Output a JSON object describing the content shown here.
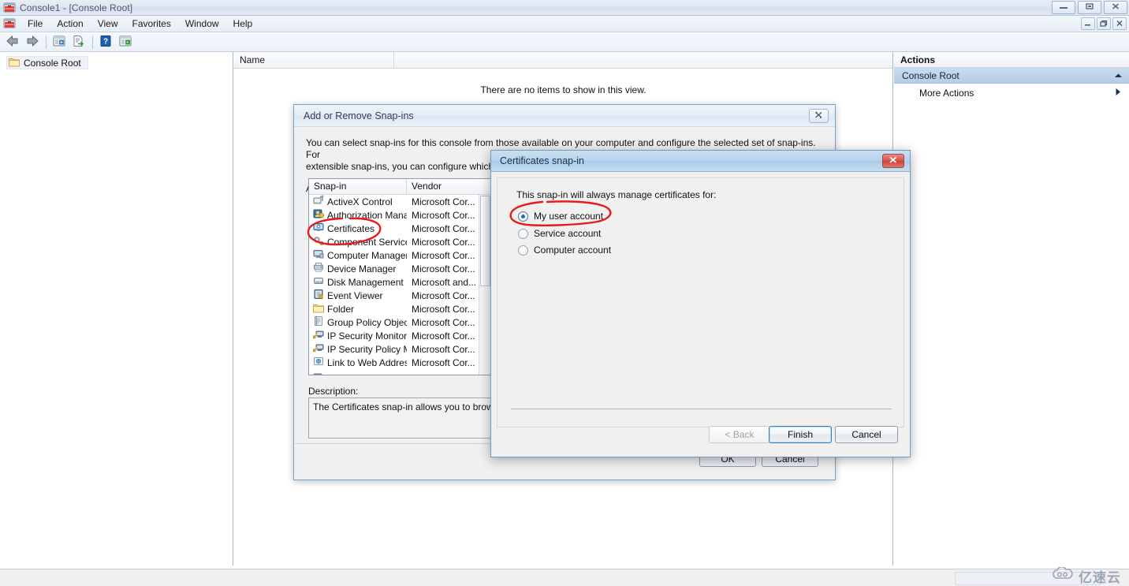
{
  "window": {
    "title": "Console1 - [Console Root]",
    "icon": "mmc-console-icon",
    "controls": {
      "minimize": "–",
      "maximize": "▣",
      "close": "✕"
    },
    "mdi_controls": {
      "minimize": "–",
      "restore": "❐",
      "close": "✕"
    }
  },
  "menu": {
    "items": [
      {
        "label": "File",
        "name": "menu-file"
      },
      {
        "label": "Action",
        "name": "menu-action"
      },
      {
        "label": "View",
        "name": "menu-view"
      },
      {
        "label": "Favorites",
        "name": "menu-favorites"
      },
      {
        "label": "Window",
        "name": "menu-window"
      },
      {
        "label": "Help",
        "name": "menu-help"
      }
    ]
  },
  "toolbar": {
    "buttons": [
      {
        "name": "back-button",
        "icon": "back-arrow-icon"
      },
      {
        "name": "forward-button",
        "icon": "forward-arrow-icon"
      },
      {
        "name": "show-hide-tree-button",
        "icon": "console-tree-icon"
      },
      {
        "name": "export-list-button",
        "icon": "export-list-icon"
      },
      {
        "name": "help-button",
        "icon": "question-mark-icon"
      },
      {
        "name": "show-action-pane-button",
        "icon": "action-pane-icon"
      }
    ]
  },
  "tree": {
    "root": {
      "label": "Console Root",
      "icon": "folder-icon"
    }
  },
  "list_pane": {
    "columns": [
      "Name",
      ""
    ],
    "empty_message": "There are no items to show in this view."
  },
  "actions_pane": {
    "title": "Actions",
    "group_label": "Console Root",
    "group_collapse_icon": "chevron-up-icon",
    "items": [
      {
        "label": "More Actions",
        "submenu_icon": "chevron-right-icon"
      }
    ]
  },
  "snapins_dialog": {
    "title": "Add or Remove Snap-ins",
    "close_label": "✕",
    "intro_line1": "You can select snap-ins for this console from those available on your computer and configure the selected set of snap-ins. For",
    "intro_line2": "extensible snap-ins, you can configure which extensions are enabled.",
    "available_label": "Available snap-ins:",
    "columns": {
      "snapin": "Snap-in",
      "vendor": "Vendor"
    },
    "rows": [
      {
        "name": "ActiveX Control",
        "vendor": "Microsoft Cor...",
        "icon": "activex-control-icon"
      },
      {
        "name": "Authorization Manager",
        "vendor": "Microsoft Cor...",
        "icon": "authorization-manager-icon"
      },
      {
        "name": "Certificates",
        "vendor": "Microsoft Cor...",
        "icon": "certificates-icon"
      },
      {
        "name": "Component Services",
        "vendor": "Microsoft Cor...",
        "icon": "component-services-icon"
      },
      {
        "name": "Computer Managem...",
        "vendor": "Microsoft Cor...",
        "icon": "computer-management-icon"
      },
      {
        "name": "Device Manager",
        "vendor": "Microsoft Cor...",
        "icon": "device-manager-icon"
      },
      {
        "name": "Disk Management",
        "vendor": "Microsoft and...",
        "icon": "disk-management-icon"
      },
      {
        "name": "Event Viewer",
        "vendor": "Microsoft Cor...",
        "icon": "event-viewer-icon"
      },
      {
        "name": "Folder",
        "vendor": "Microsoft Cor...",
        "icon": "folder-icon"
      },
      {
        "name": "Group Policy Object ...",
        "vendor": "Microsoft Cor...",
        "icon": "group-policy-icon"
      },
      {
        "name": "IP Security Monitor",
        "vendor": "Microsoft Cor...",
        "icon": "ip-security-monitor-icon"
      },
      {
        "name": "IP Security Policy M...",
        "vendor": "Microsoft Cor...",
        "icon": "ip-security-policy-icon"
      },
      {
        "name": "Link to Web Address",
        "vendor": "Microsoft Cor...",
        "icon": "link-to-web-address-icon"
      }
    ],
    "description_label": "Description:",
    "description_text": "The Certificates snap-in allows you to browse t",
    "ok_label": "OK",
    "cancel_label": "Cancel"
  },
  "certificates_dialog": {
    "title": "Certificates snap-in",
    "close_label": "✕",
    "question": "This snap-in will always manage certificates for:",
    "options": [
      {
        "label": "My user account",
        "selected": true
      },
      {
        "label": "Service account",
        "selected": false
      },
      {
        "label": "Computer account",
        "selected": false
      }
    ],
    "buttons": {
      "back": "< Back",
      "finish": "Finish",
      "cancel": "Cancel"
    }
  },
  "watermark": {
    "text": "亿速云",
    "icon": "cloud-logo-icon"
  },
  "colors": {
    "accent_blue": "#3c7fb1",
    "annotation_red": "#e81c1c",
    "selection_blue": "#b6cde6",
    "title_text": "#4a5a70"
  }
}
